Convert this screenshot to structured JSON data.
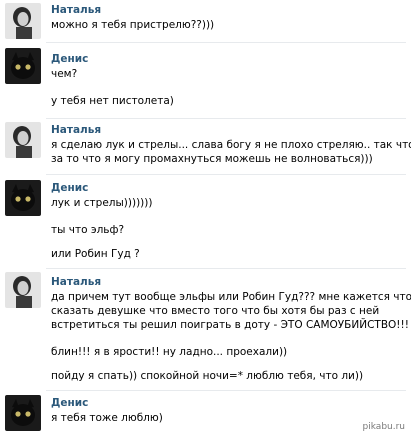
{
  "messages": [
    {
      "sender": "Наталья",
      "avatar": "avatar-natalya",
      "lines": [
        "можно я тебя пристрелю??)))"
      ]
    },
    {
      "sender": "Денис",
      "avatar": "avatar-denis",
      "lines": [
        "чем?",
        "у тебя нет пистолета)"
      ]
    },
    {
      "sender": "Наталья",
      "avatar": "avatar-natalya",
      "lines": [
        "я сделаю лук и стрелы... слава богу я не плохо стреляю.. так что",
        "за то что я могу промахнуться можешь не волноваться)))"
      ]
    },
    {
      "sender": "Денис",
      "avatar": "avatar-denis",
      "lines": [
        "лук и стрелы)))))))",
        "ты что эльф?",
        "или Робин Гуд ?"
      ]
    },
    {
      "sender": "Наталья",
      "avatar": "avatar-natalya",
      "lines": [
        "да причем тут вообще эльфы или Робин Гуд??? мне кажется что",
        "сказать девушке что вместо того что бы хотя бы раз с ней",
        "встретиться ты решил поиграть в доту - ЭТО САМОУБИЙСТВО!!!",
        "блин!!! я в ярости!! ну ладно... проехали))",
        "пойду я спать)) спокойной ночи=* люблю тебя, что ли))"
      ]
    },
    {
      "sender": "Денис",
      "avatar": "avatar-denis",
      "lines": [
        "я тебя тоже люблю)"
      ]
    }
  ],
  "watermark": "pikabu.ru"
}
